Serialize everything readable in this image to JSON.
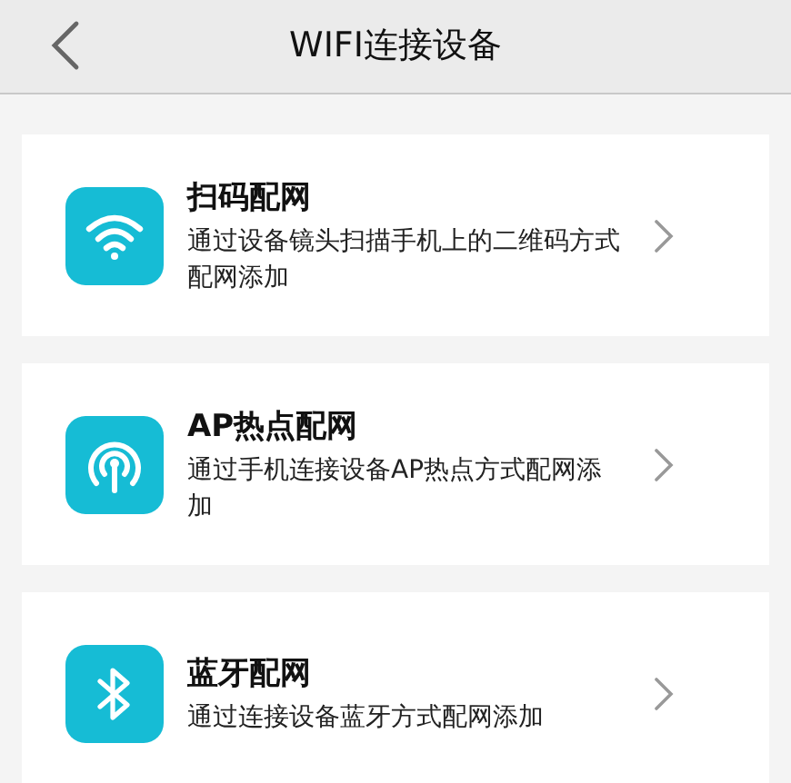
{
  "header": {
    "title": "WIFI连接设备"
  },
  "options": [
    {
      "kind": "wifi",
      "title": "扫码配网",
      "description": "通过设备镜头扫描手机上的二维码方式配网添加"
    },
    {
      "kind": "hotspot",
      "title": "AP热点配网",
      "description": "通过手机连接设备AP热点方式配网添加"
    },
    {
      "kind": "bluetooth",
      "title": "蓝牙配网",
      "description": "通过连接设备蓝牙方式配网添加"
    }
  ]
}
